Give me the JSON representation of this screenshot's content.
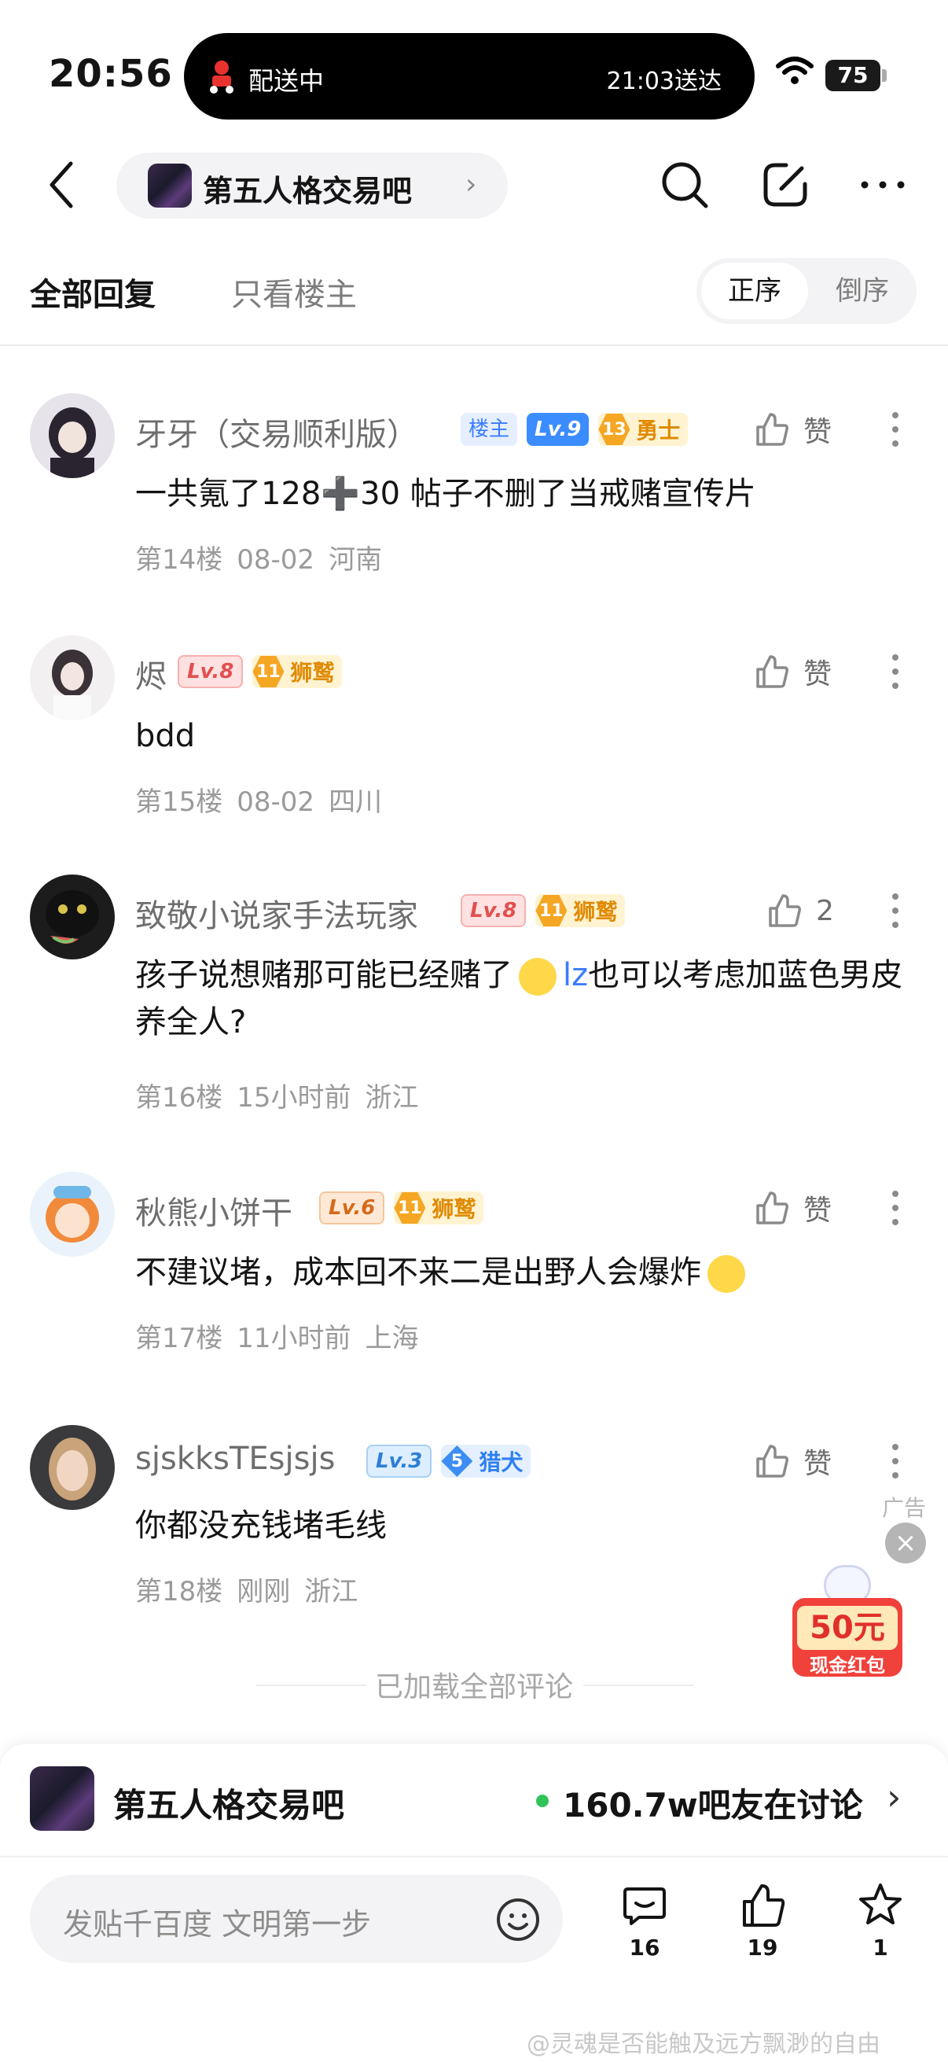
{
  "status_bar": {
    "time": "20:56",
    "delivery_status": "配送中",
    "delivery_eta": "21:03送达",
    "battery": "75"
  },
  "nav": {
    "forum_name": "第五人格交易吧",
    "forum_chevron": "›"
  },
  "tabs": {
    "all_replies": "全部回复",
    "owner_only": "只看楼主",
    "sort_asc": "正序",
    "sort_desc": "倒序"
  },
  "comments": [
    {
      "username": "牙牙（交易顺利版）",
      "owner_badge": "楼主",
      "level": "Lv.9",
      "title_num": "13",
      "title": "勇士",
      "like_label": "赞",
      "content": "一共氪了128➕30 帖子不删了当戒赌宣传片",
      "floor": "第14楼",
      "time": "08-02",
      "location": "河南"
    },
    {
      "username": "烬",
      "level": "Lv.8",
      "title_num": "11",
      "title": "狮鹫",
      "like_label": "赞",
      "content": "bdd",
      "floor": "第15楼",
      "time": "08-02",
      "location": "四川"
    },
    {
      "username": "致敬小说家手法玩家",
      "level": "Lv.8",
      "title_num": "11",
      "title": "狮鹫",
      "like_label": "2",
      "content_a": "孩子说想赌那可能已经赌了",
      "lz": "lz",
      "content_b": "也可以考虑加蓝色男皮养全人?",
      "floor": "第16楼",
      "time": "15小时前",
      "location": "浙江"
    },
    {
      "username": "秋熊小饼干",
      "level": "Lv.6",
      "title_num": "11",
      "title": "狮鹫",
      "like_label": "赞",
      "content": "不建议堵，成本回不来二是出野人会爆炸",
      "floor": "第17楼",
      "time": "11小时前",
      "location": "上海"
    },
    {
      "username": "sjskksTEsjsjs",
      "level": "Lv.3",
      "title_num": "5",
      "title": "猎犬",
      "like_label": "赞",
      "content": "你都没充钱堵毛线",
      "floor": "第18楼",
      "time": "刚刚",
      "location": "浙江"
    }
  ],
  "ad": {
    "label": "广告",
    "amount": "50元",
    "caption": "现金红包"
  },
  "loaded_text": "已加载全部评论",
  "forum_bar": {
    "name": "第五人格交易吧",
    "discussing": "160.7w吧友在讨论",
    "chevron": "›"
  },
  "input_bar": {
    "placeholder": "发贴千百度 文明第一步",
    "comments_count": "16",
    "likes_count": "19",
    "favorites_count": "1"
  },
  "watermark": "@灵魂是否能触及远方飘渺的自由",
  "colors": {
    "accent_blue": "#3b7cff",
    "online_green": "#2fc35a",
    "text_gray": "#9a9a9a"
  }
}
